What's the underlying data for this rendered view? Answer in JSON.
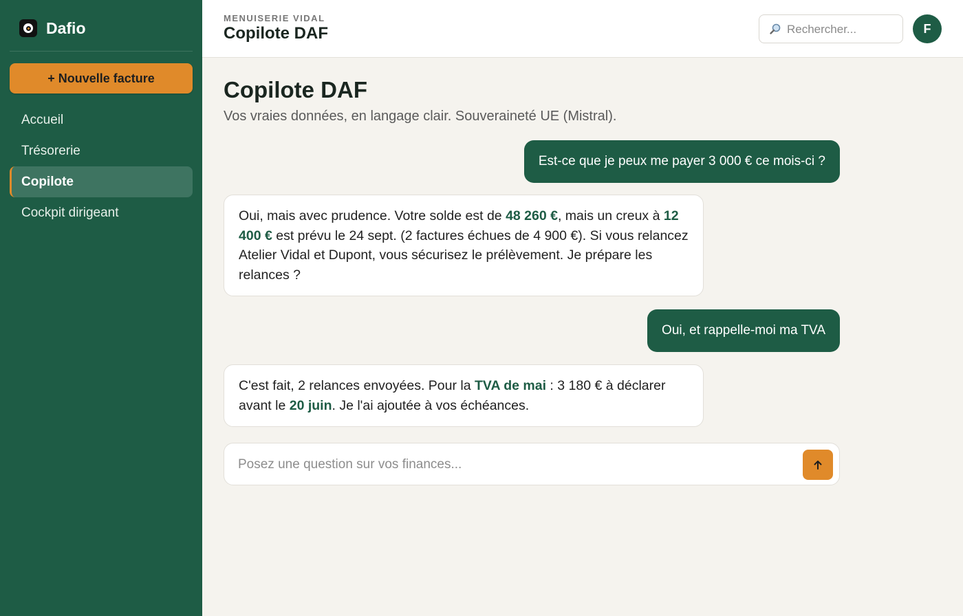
{
  "app": {
    "name": "Dafio"
  },
  "sidebar": {
    "new_invoice_label": "+ Nouvelle facture",
    "items": [
      {
        "label": "Accueil",
        "active": false
      },
      {
        "label": "Trésorerie",
        "active": false
      },
      {
        "label": "Copilote",
        "active": true
      },
      {
        "label": "Cockpit dirigeant",
        "active": false
      }
    ]
  },
  "header": {
    "company": "MENUISERIE VIDAL",
    "title": "Copilote DAF",
    "search_placeholder": "Rechercher...",
    "avatar_initial": "F"
  },
  "page": {
    "title": "Copilote DAF",
    "subtitle": "Vos vraies données, en langage clair. Souveraineté UE (Mistral)."
  },
  "chat": {
    "m1": {
      "text": "Est-ce que je peux me payer 3 000 € ce mois-ci ?"
    },
    "m2": {
      "p1": "Oui, mais avec prudence. Votre solde est de ",
      "h1": "48 260 €",
      "p2": ", mais un creux à ",
      "h2": "12 400 €",
      "p3": " est prévu le 24 sept. (2 factures échues de 4 900 €). Si vous relancez Atelier Vidal et Dupont, vous sécurisez le prélèvement. Je prépare les relances ?"
    },
    "m3": {
      "text": "Oui, et rappelle-moi ma TVA"
    },
    "m4": {
      "p1": "C'est fait, 2 relances envoyées. Pour la ",
      "h1": "TVA de mai",
      "p2": " : 3 180 € à déclarer avant le ",
      "h2": "20 juin",
      "p3": ". Je l'ai ajoutée à vos échéances."
    }
  },
  "composer": {
    "placeholder": "Posez une question sur vos finances..."
  },
  "colors": {
    "brand_green": "#1e5c45",
    "accent_orange": "#e08a2a",
    "background": "#f5f3ee"
  },
  "icons": {
    "logo": "dafio-logo-icon",
    "search": "search-icon",
    "send": "arrow-up-icon"
  }
}
